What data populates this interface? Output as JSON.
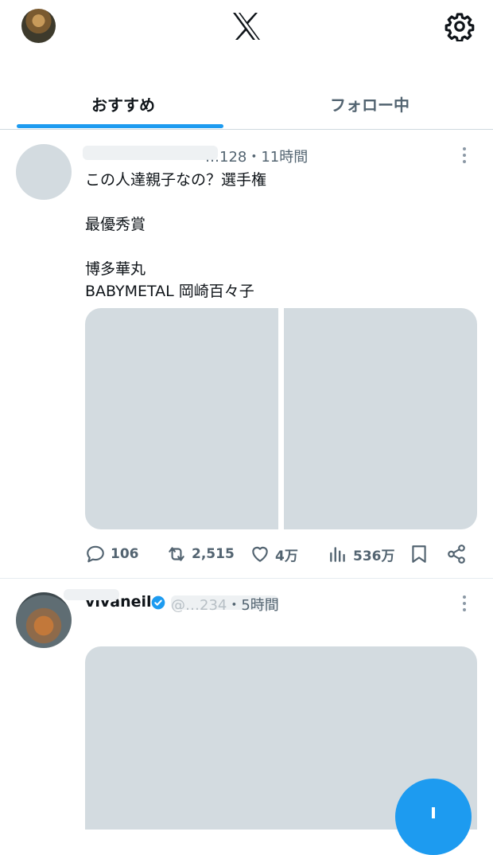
{
  "header": {
    "logo": "X"
  },
  "tabs": [
    {
      "label": "おすすめ",
      "active": true
    },
    {
      "label": "フォロー中",
      "active": false
    }
  ],
  "tweets": [
    {
      "name": "",
      "handle_visible": "…128",
      "time": "・11時間",
      "lines": [
        "この人達親子なの？選手権",
        "",
        "最優秀賞",
        "",
        "博多華丸",
        "BABYMETAL 岡崎百々子"
      ],
      "replies": "106",
      "retweets": "2,515",
      "likes": "4万",
      "views": "536万"
    },
    {
      "name": "vivaneil",
      "verified": true,
      "handle_visible": "@…234",
      "time": "・5時間"
    }
  ],
  "colors": {
    "accent": "#1d9bf0",
    "placeholder": "#d3dbe0",
    "muted": "#536471"
  }
}
